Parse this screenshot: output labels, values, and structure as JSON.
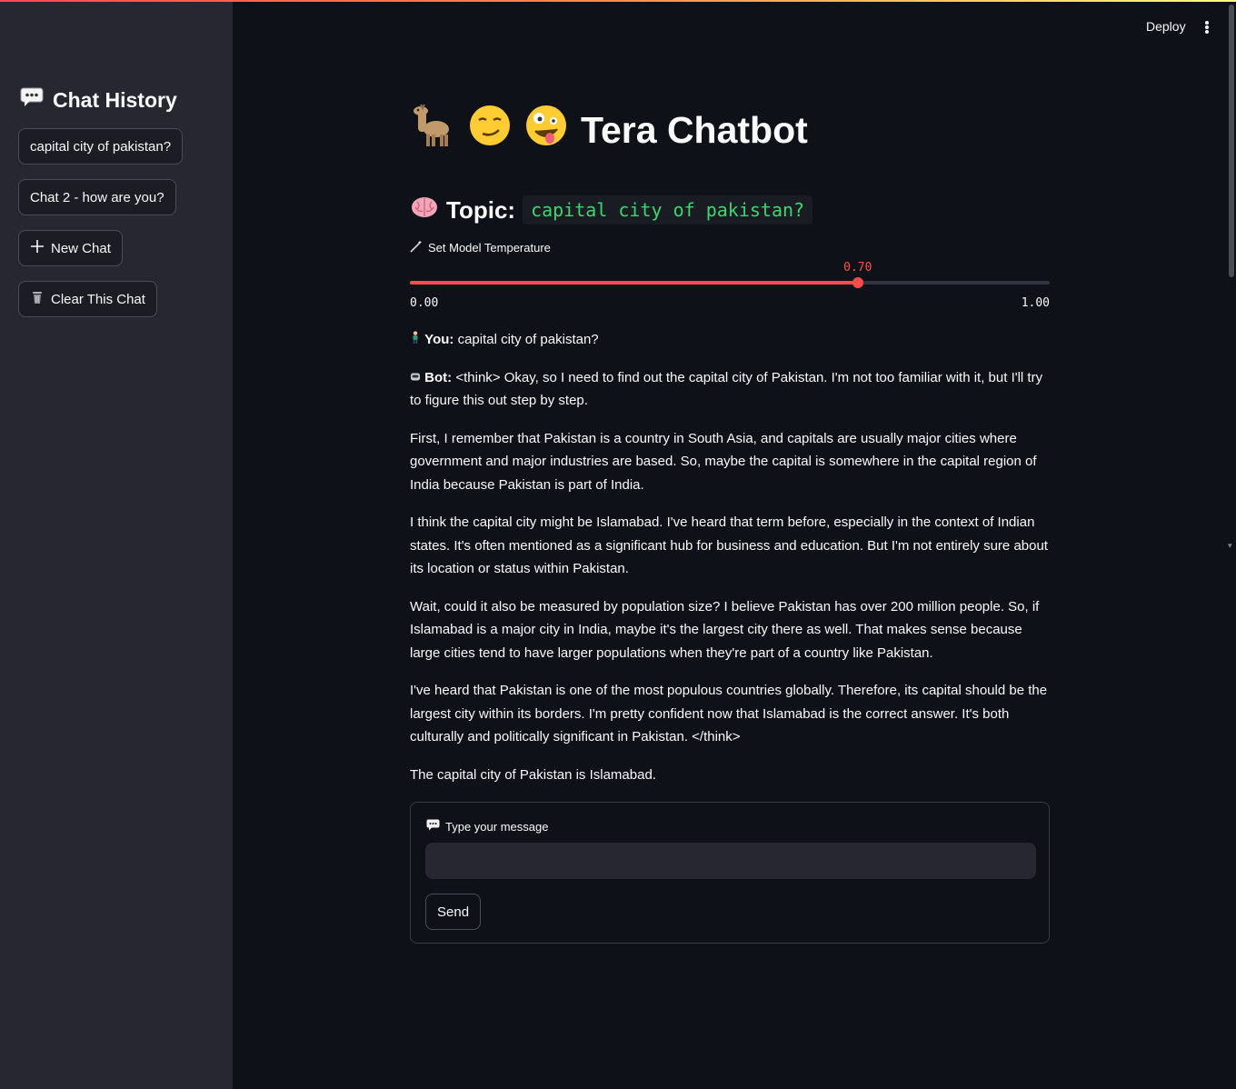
{
  "header": {
    "deploy_label": "Deploy",
    "menu_icon": "more-vertical-icon"
  },
  "sidebar": {
    "title": "Chat History",
    "title_icon": "speech-bubble-icon",
    "chats": [
      {
        "label": "capital city of pakistan?"
      },
      {
        "label": "Chat 2 - how are you?"
      }
    ],
    "new_chat_label": "New Chat",
    "clear_chat_label": "Clear This Chat"
  },
  "main": {
    "title": "Tera Chatbot",
    "title_icons": [
      "llama-emoji",
      "smirk-face-emoji",
      "zany-face-emoji"
    ],
    "topic_label": "Topic:",
    "topic_value": "capital city of pakistan?",
    "topic_icon": "brain-emoji"
  },
  "slider": {
    "label": "Set Model Temperature",
    "icon": "wand-icon",
    "min_label": "0.00",
    "max_label": "1.00",
    "value_label": "0.70",
    "value": 0.7,
    "min": 0,
    "max": 1
  },
  "messages": {
    "user_label": "You:",
    "user_text": "capital city of pakistan?",
    "bot_label": "Bot:",
    "bot_paragraphs": [
      "<think> Okay, so I need to find out the capital city of Pakistan. I'm not too familiar with it, but I'll try to figure this out step by step.",
      "First, I remember that Pakistan is a country in South Asia, and capitals are usually major cities where government and major industries are based. So, maybe the capital is somewhere in the capital region of India because Pakistan is part of India.",
      "I think the capital city might be Islamabad. I've heard that term before, especially in the context of Indian states. It's often mentioned as a significant hub for business and education. But I'm not entirely sure about its location or status within Pakistan.",
      "Wait, could it also be measured by population size? I believe Pakistan has over 200 million people. So, if Islamabad is a major city in India, maybe it's the largest city there as well. That makes sense because large cities tend to have larger populations when they're part of a country like Pakistan.",
      "I've heard that Pakistan is one of the most populous countries globally. Therefore, its capital should be the largest city within its borders. I'm pretty confident now that Islamabad is the correct answer. It's both culturally and politically significant in Pakistan. </think>",
      "The capital city of Pakistan is Islamabad."
    ]
  },
  "form": {
    "label": "Type your message",
    "input_value": "",
    "send_label": "Send"
  },
  "colors": {
    "accent": "#ff4b4b",
    "code_green": "#3dd56d",
    "background": "#0e1117",
    "sidebar": "#262730"
  }
}
